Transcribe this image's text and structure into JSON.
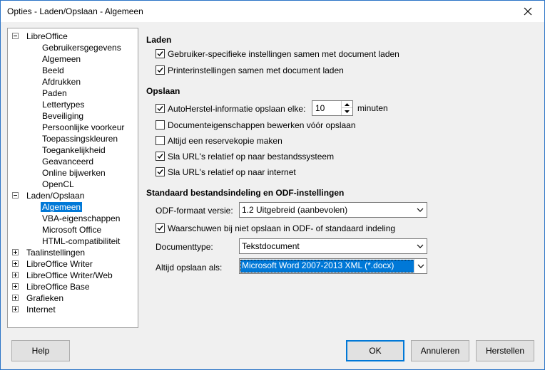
{
  "window": {
    "title": "Opties - Laden/Opslaan - Algemeen"
  },
  "tree": [
    {
      "label": "LibreOffice",
      "level": 0,
      "state": "expanded"
    },
    {
      "label": "Gebruikersgegevens",
      "level": 1
    },
    {
      "label": "Algemeen",
      "level": 1
    },
    {
      "label": "Beeld",
      "level": 1
    },
    {
      "label": "Afdrukken",
      "level": 1
    },
    {
      "label": "Paden",
      "level": 1
    },
    {
      "label": "Lettertypes",
      "level": 1
    },
    {
      "label": "Beveiliging",
      "level": 1
    },
    {
      "label": "Persoonlijke voorkeur",
      "level": 1
    },
    {
      "label": "Toepassingskleuren",
      "level": 1
    },
    {
      "label": "Toegankelijkheid",
      "level": 1
    },
    {
      "label": "Geavanceerd",
      "level": 1
    },
    {
      "label": "Online bijwerken",
      "level": 1
    },
    {
      "label": "OpenCL",
      "level": 1
    },
    {
      "label": "Laden/Opslaan",
      "level": 0,
      "state": "expanded"
    },
    {
      "label": "Algemeen",
      "level": 1,
      "selected": true
    },
    {
      "label": "VBA-eigenschappen",
      "level": 1
    },
    {
      "label": "Microsoft Office",
      "level": 1
    },
    {
      "label": "HTML-compatibiliteit",
      "level": 1
    },
    {
      "label": "Taalinstellingen",
      "level": 0,
      "state": "collapsed"
    },
    {
      "label": "LibreOffice Writer",
      "level": 0,
      "state": "collapsed"
    },
    {
      "label": "LibreOffice Writer/Web",
      "level": 0,
      "state": "collapsed"
    },
    {
      "label": "LibreOffice Base",
      "level": 0,
      "state": "collapsed"
    },
    {
      "label": "Grafieken",
      "level": 0,
      "state": "collapsed"
    },
    {
      "label": "Internet",
      "level": 0,
      "state": "collapsed"
    }
  ],
  "laden": {
    "title": "Laden",
    "options": [
      {
        "label": "Gebruiker-specifieke instellingen samen met document laden",
        "checked": true
      },
      {
        "label": "Printerinstellingen samen met document laden",
        "checked": true
      }
    ]
  },
  "opslaan": {
    "title": "Opslaan",
    "autorecover": {
      "label": "AutoHerstel-informatie opslaan elke:",
      "checked": true,
      "value": "10",
      "unit": "minuten"
    },
    "options": [
      {
        "label": "Documenteigenschappen bewerken vóór opslaan",
        "checked": false
      },
      {
        "label": "Altijd een reservekopie maken",
        "checked": false
      },
      {
        "label": "Sla URL's relatief op naar bestandssysteem",
        "checked": true
      },
      {
        "label": "Sla URL's relatief op naar internet",
        "checked": true
      }
    ]
  },
  "standaard": {
    "title": "Standaard bestandsindeling en ODF-instellingen",
    "odf_label": "ODF-formaat versie:",
    "odf_value": "1.2 Uitgebreid (aanbevolen)",
    "warn": {
      "label": "Waarschuwen bij niet opslaan in ODF- of standaard indeling",
      "checked": true
    },
    "doctype_label": "Documenttype:",
    "doctype_value": "Tekstdocument",
    "saveas_label": "Altijd opslaan als:",
    "saveas_value": "Microsoft Word 2007-2013 XML (*.docx)"
  },
  "buttons": {
    "help": "Help",
    "ok": "OK",
    "cancel": "Annuleren",
    "reset": "Herstellen"
  },
  "colors": {
    "accent": "#0078d7"
  }
}
